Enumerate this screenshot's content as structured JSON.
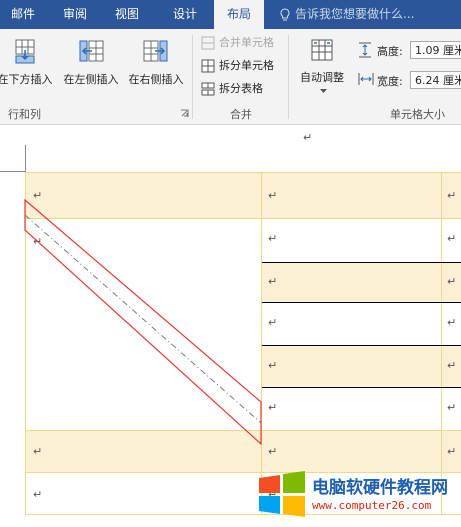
{
  "tabs": [
    {
      "label": "邮件"
    },
    {
      "label": "审阅"
    },
    {
      "label": "视图"
    },
    {
      "label": "设计"
    },
    {
      "label": "布局"
    }
  ],
  "tell_me": "告诉我您想要做什么...",
  "rows_cols": {
    "insert_below": "在下方插入",
    "insert_left": "在左侧插入",
    "insert_right": "在右侧插入",
    "group_label": "行和列"
  },
  "merge": {
    "merge_cells": "合并单元格",
    "split_cells": "拆分单元格",
    "split_table": "拆分表格",
    "group_label": "合并"
  },
  "cell_size": {
    "autofit": "自动调整",
    "height_label": "高度:",
    "height_value": "1.09 厘米",
    "width_label": "宽度:",
    "width_value": "6.24 厘米",
    "group_label": "单元格大小"
  },
  "doc": {
    "para_mark": "↵"
  },
  "watermark": {
    "title": "电脑软硬件教程网",
    "url": "www.computer26.com"
  },
  "colors": {
    "ribbon_blue": "#2b579a",
    "cell_shade": "#fcf0d4",
    "selection_red": "#e53935"
  }
}
